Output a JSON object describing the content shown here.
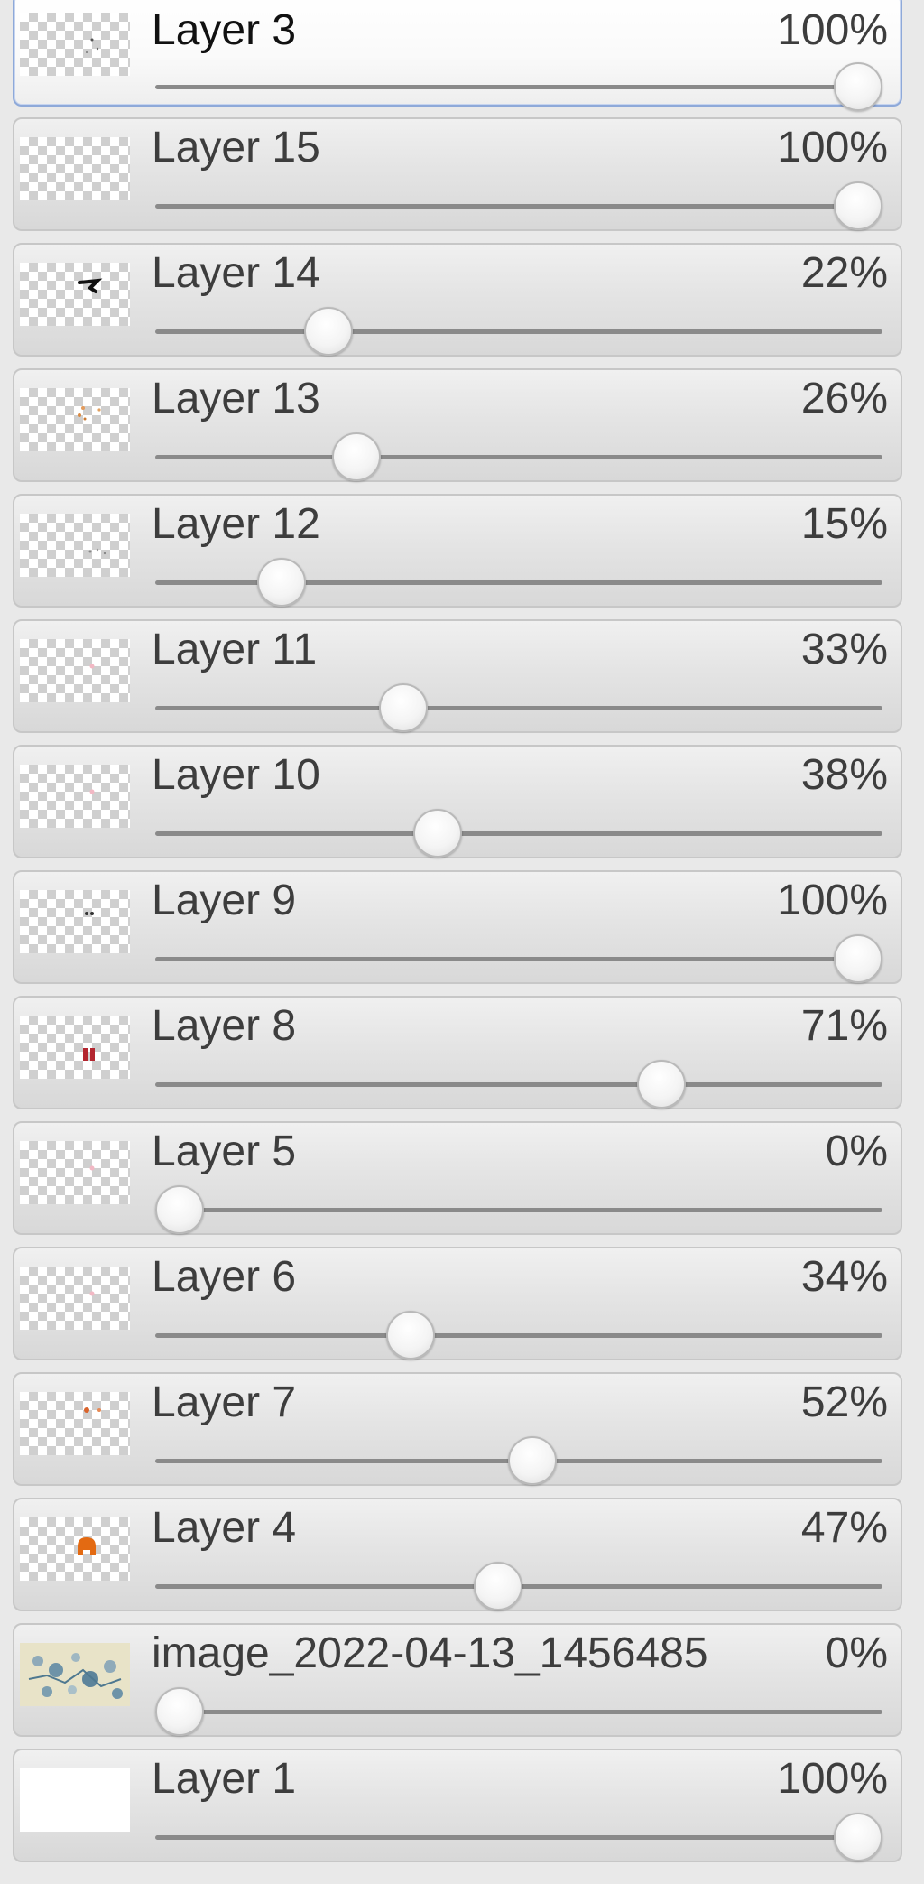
{
  "layers_panel": {
    "layers": [
      {
        "name": "Layer 3",
        "opacity_label": "100%",
        "opacity": 100,
        "selected": true,
        "thumb_icon": "sparse-dark-specks-thumbnail"
      },
      {
        "name": "Layer 15",
        "opacity_label": "100%",
        "opacity": 100,
        "selected": false,
        "thumb_icon": "empty-transparent-thumbnail"
      },
      {
        "name": "Layer 14",
        "opacity_label": "22%",
        "opacity": 22,
        "selected": false,
        "thumb_icon": "black-stroke-thumbnail"
      },
      {
        "name": "Layer 13",
        "opacity_label": "26%",
        "opacity": 26,
        "selected": false,
        "thumb_icon": "orange-specks-thumbnail"
      },
      {
        "name": "Layer 12",
        "opacity_label": "15%",
        "opacity": 15,
        "selected": false,
        "thumb_icon": "grey-specks-thumbnail"
      },
      {
        "name": "Layer 11",
        "opacity_label": "33%",
        "opacity": 33,
        "selected": false,
        "thumb_icon": "pink-dot-thumbnail"
      },
      {
        "name": "Layer 10",
        "opacity_label": "38%",
        "opacity": 38,
        "selected": false,
        "thumb_icon": "pink-dot-thumbnail"
      },
      {
        "name": "Layer 9",
        "opacity_label": "100%",
        "opacity": 100,
        "selected": false,
        "thumb_icon": "dark-dots-thumbnail"
      },
      {
        "name": "Layer 8",
        "opacity_label": "71%",
        "opacity": 71,
        "selected": false,
        "thumb_icon": "red-marks-thumbnail"
      },
      {
        "name": "Layer 5",
        "opacity_label": "0%",
        "opacity": 0,
        "selected": false,
        "thumb_icon": "pink-dot-thumbnail"
      },
      {
        "name": "Layer 6",
        "opacity_label": "34%",
        "opacity": 34,
        "selected": false,
        "thumb_icon": "pink-dot-thumbnail"
      },
      {
        "name": "Layer 7",
        "opacity_label": "52%",
        "opacity": 52,
        "selected": false,
        "thumb_icon": "orange-dots-thumbnail"
      },
      {
        "name": "Layer 4",
        "opacity_label": "47%",
        "opacity": 47,
        "selected": false,
        "thumb_icon": "orange-shape-thumbnail"
      },
      {
        "name": "image_2022-04-13_1456485",
        "opacity_label": "0%",
        "opacity": 0,
        "selected": false,
        "thumb_icon": "photo-image-thumbnail"
      },
      {
        "name": "Layer 1",
        "opacity_label": "100%",
        "opacity": 100,
        "selected": false,
        "thumb_icon": "white-fill-thumbnail"
      }
    ]
  },
  "colors": {
    "selected_border": "#8ea9d9",
    "row_border": "#c7c7c7",
    "text": "#3d3d3d",
    "track": "#8a8a8a"
  }
}
